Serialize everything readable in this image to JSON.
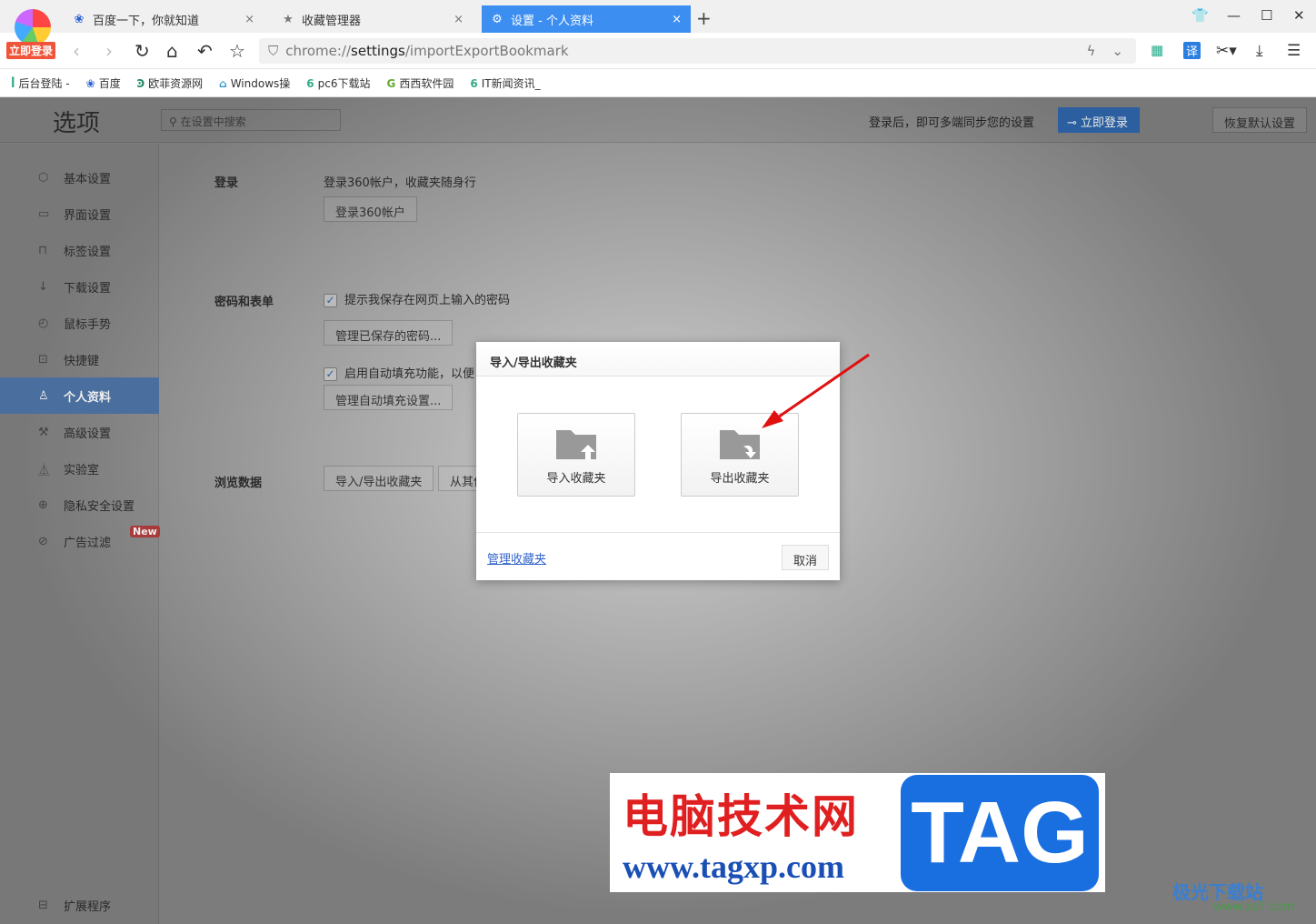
{
  "browser": {
    "login_badge": "立即登录",
    "tabs": [
      {
        "label": "百度一下，你就知道",
        "icon": "baidu-paw-icon"
      },
      {
        "label": "收藏管理器",
        "icon": "star-icon"
      },
      {
        "label": "设置 - 个人资料",
        "icon": "gear-icon",
        "active": true
      }
    ],
    "url_prefix": "chrome://",
    "url_host": "settings",
    "url_path": "/importExportBookmark",
    "bookmarks": [
      "后台登陆 -",
      "百度",
      "欧菲资源网",
      "Windows操",
      "pc6下载站",
      "西西软件园",
      "IT新闻资讯_"
    ],
    "translate": "译"
  },
  "settings": {
    "title": "选项",
    "search_placeholder": "在设置中搜索",
    "sync_text": "登录后，即可多端同步您的设置",
    "login_button": "立即登录",
    "restore_button": "恢复默认设置",
    "sidebar": [
      {
        "label": "基本设置",
        "icon": "hexagon-icon"
      },
      {
        "label": "界面设置",
        "icon": "window-icon"
      },
      {
        "label": "标签设置",
        "icon": "tab-icon"
      },
      {
        "label": "下载设置",
        "icon": "download-icon"
      },
      {
        "label": "鼠标手势",
        "icon": "mouse-icon"
      },
      {
        "label": "快捷键",
        "icon": "keyboard-icon"
      },
      {
        "label": "个人资料",
        "icon": "user-icon",
        "active": true
      },
      {
        "label": "高级设置",
        "icon": "wrench-icon"
      },
      {
        "label": "实验室",
        "icon": "flask-icon"
      },
      {
        "label": "隐私安全设置",
        "icon": "shield-icon"
      },
      {
        "label": "广告过滤",
        "icon": "block-icon"
      }
    ],
    "new_badge": "New",
    "extensions": "扩展程序",
    "login_section": {
      "title": "登录",
      "desc": "登录360帐户，收藏夹随身行",
      "button": "登录360帐户"
    },
    "password_section": {
      "title": "密码和表单",
      "check1": "提示我保存在网页上输入的密码",
      "button1": "管理已保存的密码...",
      "check2": "启用自动填充功能，以便",
      "button2": "管理自动填充设置..."
    },
    "browse_section": {
      "title": "浏览数据",
      "button1": "导入/导出收藏夹",
      "button2": "从其他"
    }
  },
  "dialog": {
    "title": "导入/导出收藏夹",
    "import": "导入收藏夹",
    "export": "导出收藏夹",
    "manage_link": "管理收藏夹",
    "cancel": "取消"
  },
  "watermark": {
    "cn": "电脑技术网",
    "url": "www.tagxp.com",
    "tag": "TAG",
    "site2": "极光下载站",
    "url2": "www.xz7.com"
  }
}
